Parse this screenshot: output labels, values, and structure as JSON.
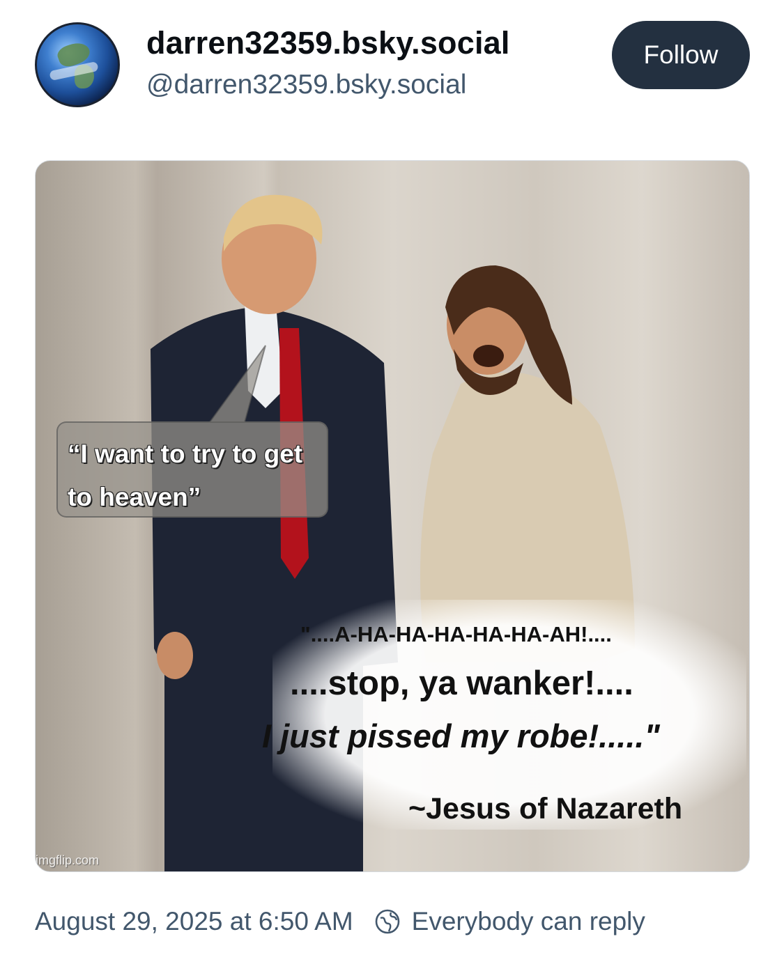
{
  "post": {
    "display_name": "darren32359.bsky.social",
    "handle": "@darren32359.bsky.social",
    "follow_label": "Follow",
    "avatar_icon": "earth-globe-avatar"
  },
  "meme": {
    "speech_bubble": "“I want to try to get to heaven”",
    "quote_line1": "\"....A-HA-HA-HA-HA-HA-AH!....",
    "quote_line2": "....stop, ya wanker!....",
    "quote_line3": "I just pissed my robe!.....\"",
    "quote_attribution": "~Jesus of Nazareth",
    "watermark": "imgflip.com"
  },
  "footer": {
    "timestamp": "August 29, 2025 at 6:50 AM",
    "reply_icon": "globe-reply-icon",
    "reply_setting": "Everybody can reply"
  },
  "colors": {
    "follow_bg": "#233040",
    "muted_text": "#42576c"
  }
}
